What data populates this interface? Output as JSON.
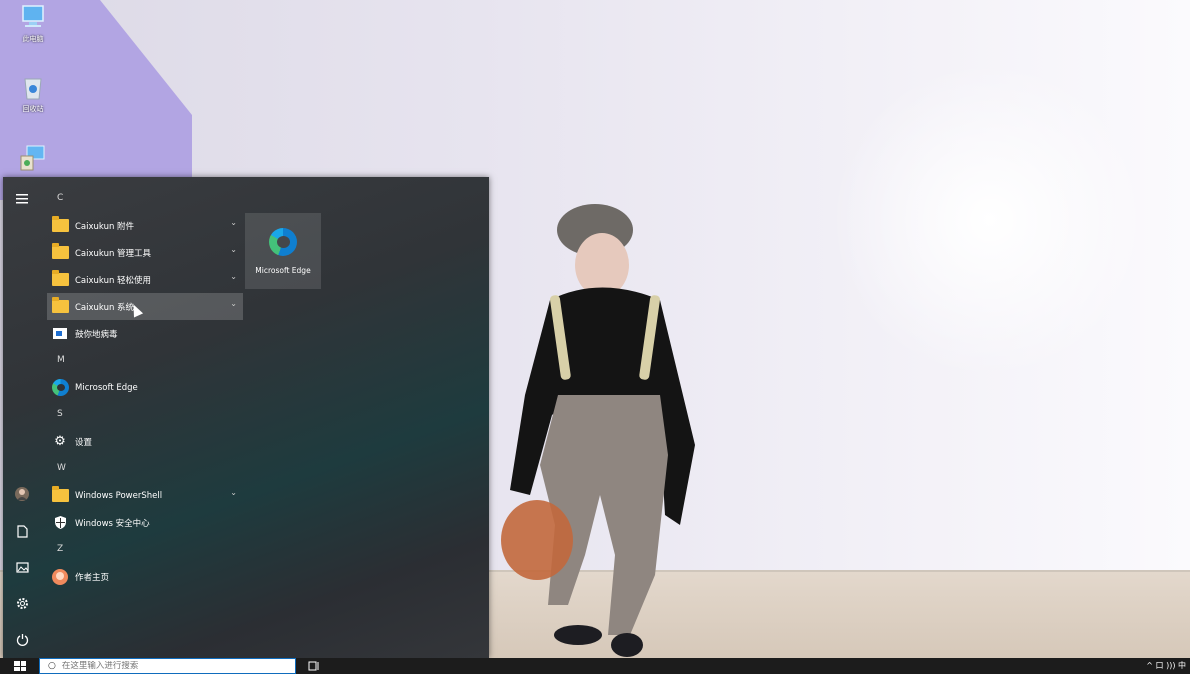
{
  "desktop": {
    "icons": [
      {
        "label": "此电脑",
        "icon": "computer-icon"
      },
      {
        "label": "回收站",
        "icon": "recycle-bin-icon"
      },
      {
        "label": "",
        "icon": "control-panel-icon"
      }
    ]
  },
  "start_menu": {
    "rail": [
      "hamburger-menu-icon",
      "user-avatar",
      "documents-icon",
      "pictures-icon",
      "settings-icon",
      "power-icon"
    ],
    "groups": [
      {
        "letter": "C",
        "items": [
          {
            "label": "Caixukun 附件",
            "icon": "folder-icon",
            "expandable": true
          },
          {
            "label": "Caixukun 管理工具",
            "icon": "folder-icon",
            "expandable": true
          },
          {
            "label": "Caixukun 轻松使用",
            "icon": "folder-icon",
            "expandable": true
          },
          {
            "label": "Caixukun 系统",
            "icon": "folder-icon",
            "expandable": true,
            "hovered": true
          },
          {
            "label": "鼓你地病毒",
            "icon": "app-icon",
            "expandable": false
          }
        ]
      },
      {
        "letter": "M",
        "items": [
          {
            "label": "Microsoft Edge",
            "icon": "edge-icon",
            "expandable": false
          }
        ]
      },
      {
        "letter": "S",
        "items": [
          {
            "label": "设置",
            "icon": "gear-icon",
            "expandable": false
          }
        ]
      },
      {
        "letter": "W",
        "items": [
          {
            "label": "Windows PowerShell",
            "icon": "folder-icon",
            "expandable": true
          },
          {
            "label": "Windows 安全中心",
            "icon": "shield-icon",
            "expandable": false
          }
        ]
      },
      {
        "letter": "Z",
        "items": [
          {
            "label": "作者主页",
            "icon": "author-icon",
            "expandable": false
          }
        ]
      }
    ],
    "tiles": [
      {
        "label": "Microsoft Edge",
        "icon": "edge-icon"
      }
    ]
  },
  "taskbar": {
    "search_placeholder": "在这里输入进行搜索",
    "tray_text": "^ 口 ))) 中"
  }
}
